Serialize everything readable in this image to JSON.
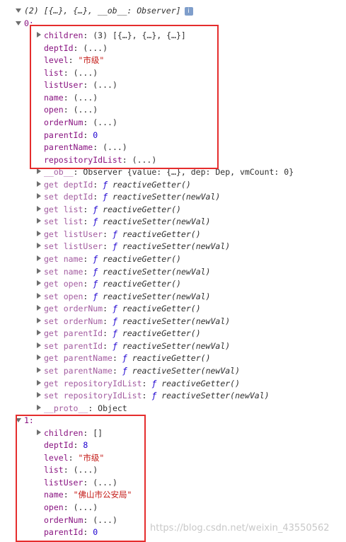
{
  "header": {
    "text": "(2) [{…}, {…}, __ob__: Observer]",
    "info_badge": "i"
  },
  "item0": {
    "index_label": "0:",
    "rows": [
      {
        "key": "children",
        "sep": ": ",
        "value": "(3) [{…}, {…}, {…}]",
        "value_style": "plain",
        "expander": true
      },
      {
        "key": "deptId",
        "sep": ": ",
        "value": "(...)",
        "value_style": "plain"
      },
      {
        "key": "level",
        "sep": ": ",
        "value": "\"市级\"",
        "value_style": "str"
      },
      {
        "key": "list",
        "sep": ": ",
        "value": "(...)",
        "value_style": "plain"
      },
      {
        "key": "listUser",
        "sep": ": ",
        "value": "(...)",
        "value_style": "plain"
      },
      {
        "key": "name",
        "sep": ": ",
        "value": "(...)",
        "value_style": "plain"
      },
      {
        "key": "open",
        "sep": ": ",
        "value": "(...)",
        "value_style": "plain"
      },
      {
        "key": "orderNum",
        "sep": ": ",
        "value": "(...)",
        "value_style": "plain"
      },
      {
        "key": "parentId",
        "sep": ": ",
        "value": "0",
        "value_style": "num"
      },
      {
        "key": "parentName",
        "sep": ": ",
        "value": "(...)",
        "value_style": "plain"
      },
      {
        "key": "repositoryIdList",
        "sep": ": ",
        "value": "(...)",
        "value_style": "plain"
      }
    ],
    "ob_row": {
      "key": "__ob__",
      "sep": ": ",
      "value": "Observer {value: {…}, dep: Dep, vmCount: 0}"
    },
    "accessors": [
      {
        "kind": "get",
        "prop": "deptId",
        "fn": "reactiveGetter",
        "args": "()"
      },
      {
        "kind": "set",
        "prop": "deptId",
        "fn": "reactiveSetter",
        "args": "(newVal)"
      },
      {
        "kind": "get",
        "prop": "list",
        "fn": "reactiveGetter",
        "args": "()"
      },
      {
        "kind": "set",
        "prop": "list",
        "fn": "reactiveSetter",
        "args": "(newVal)"
      },
      {
        "kind": "get",
        "prop": "listUser",
        "fn": "reactiveGetter",
        "args": "()"
      },
      {
        "kind": "set",
        "prop": "listUser",
        "fn": "reactiveSetter",
        "args": "(newVal)"
      },
      {
        "kind": "get",
        "prop": "name",
        "fn": "reactiveGetter",
        "args": "()"
      },
      {
        "kind": "set",
        "prop": "name",
        "fn": "reactiveSetter",
        "args": "(newVal)"
      },
      {
        "kind": "get",
        "prop": "open",
        "fn": "reactiveGetter",
        "args": "()"
      },
      {
        "kind": "set",
        "prop": "open",
        "fn": "reactiveSetter",
        "args": "(newVal)"
      },
      {
        "kind": "get",
        "prop": "orderNum",
        "fn": "reactiveGetter",
        "args": "()"
      },
      {
        "kind": "set",
        "prop": "orderNum",
        "fn": "reactiveSetter",
        "args": "(newVal)"
      },
      {
        "kind": "get",
        "prop": "parentId",
        "fn": "reactiveGetter",
        "args": "()"
      },
      {
        "kind": "set",
        "prop": "parentId",
        "fn": "reactiveSetter",
        "args": "(newVal)"
      },
      {
        "kind": "get",
        "prop": "parentName",
        "fn": "reactiveGetter",
        "args": "()"
      },
      {
        "kind": "set",
        "prop": "parentName",
        "fn": "reactiveSetter",
        "args": "(newVal)"
      },
      {
        "kind": "get",
        "prop": "repositoryIdList",
        "fn": "reactiveGetter",
        "args": "()"
      },
      {
        "kind": "set",
        "prop": "repositoryIdList",
        "fn": "reactiveSetter",
        "args": "(newVal)"
      }
    ],
    "proto_row": {
      "key": "__proto__",
      "sep": ": ",
      "value": "Object"
    },
    "fn_glyph": "ƒ"
  },
  "item1": {
    "index_label": "1:",
    "rows": [
      {
        "key": "children",
        "sep": ": ",
        "value": "[]",
        "value_style": "plain",
        "expander": true
      },
      {
        "key": "deptId",
        "sep": ": ",
        "value": "8",
        "value_style": "num"
      },
      {
        "key": "level",
        "sep": ": ",
        "value": "\"市级\"",
        "value_style": "str"
      },
      {
        "key": "list",
        "sep": ": ",
        "value": "(...)",
        "value_style": "plain"
      },
      {
        "key": "listUser",
        "sep": ": ",
        "value": "(...)",
        "value_style": "plain"
      },
      {
        "key": "name",
        "sep": ": ",
        "value": "\"佛山市公安局\"",
        "value_style": "str"
      },
      {
        "key": "open",
        "sep": ": ",
        "value": "(...)",
        "value_style": "plain"
      },
      {
        "key": "orderNum",
        "sep": ": ",
        "value": "(...)",
        "value_style": "plain"
      },
      {
        "key": "parentId",
        "sep": ": ",
        "value": "0",
        "value_style": "num"
      }
    ]
  },
  "watermark": "https://blog.csdn.net/weixin_43550562",
  "colors": {
    "highlight_box": "#e52d2d",
    "key": "#881280",
    "number": "#1c00cf",
    "string": "#c41a16"
  }
}
